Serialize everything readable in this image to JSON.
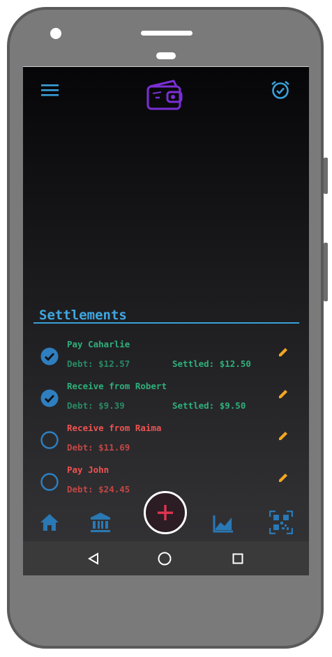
{
  "colors": {
    "accent": "#40a6e0",
    "settled_green": "#2fb07a",
    "unsettled_red": "#ef5350",
    "edit_orange": "#f5a623",
    "logo_purple": "#7b2fd6",
    "fab_plus": "#e03450"
  },
  "appbar": {
    "menu_icon": "hamburger-menu-icon",
    "logo_icon": "wallet-logo-icon",
    "alarm_icon": "alarm-clock-check-icon"
  },
  "settlements": {
    "title": "Settlements",
    "items": [
      {
        "name": "Pay Caharlie",
        "debt": "Debt: $12.57",
        "settled": "Settled: $12.50",
        "checked": true,
        "status": "settled"
      },
      {
        "name": "Receive from Robert",
        "debt": "Debt: $9.39",
        "settled": "Settled: $9.50",
        "checked": true,
        "status": "settled"
      },
      {
        "name": "Receive from Raima",
        "debt": "Debt: $11.69",
        "settled": "",
        "checked": false,
        "status": "unsettled"
      },
      {
        "name": "Pay John",
        "debt": "Debt: $24.45",
        "settled": "",
        "checked": false,
        "status": "unsettled"
      }
    ]
  },
  "bottom_nav": {
    "items": [
      "home-icon",
      "bank-icon",
      "add-icon",
      "chart-icon",
      "qr-code-icon"
    ]
  },
  "system_nav": {
    "items": [
      "back-triangle-icon",
      "home-circle-icon",
      "recents-square-icon"
    ]
  }
}
